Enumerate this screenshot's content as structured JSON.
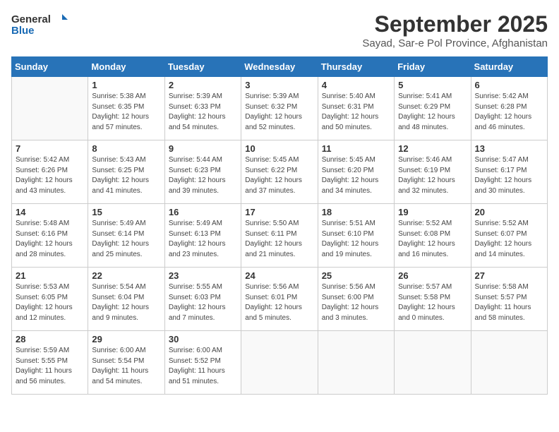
{
  "logo": {
    "line1": "General",
    "line2": "Blue"
  },
  "title": "September 2025",
  "location": "Sayad, Sar-e Pol Province, Afghanistan",
  "weekdays": [
    "Sunday",
    "Monday",
    "Tuesday",
    "Wednesday",
    "Thursday",
    "Friday",
    "Saturday"
  ],
  "weeks": [
    [
      {
        "day": "",
        "info": ""
      },
      {
        "day": "1",
        "info": "Sunrise: 5:38 AM\nSunset: 6:35 PM\nDaylight: 12 hours\nand 57 minutes."
      },
      {
        "day": "2",
        "info": "Sunrise: 5:39 AM\nSunset: 6:33 PM\nDaylight: 12 hours\nand 54 minutes."
      },
      {
        "day": "3",
        "info": "Sunrise: 5:39 AM\nSunset: 6:32 PM\nDaylight: 12 hours\nand 52 minutes."
      },
      {
        "day": "4",
        "info": "Sunrise: 5:40 AM\nSunset: 6:31 PM\nDaylight: 12 hours\nand 50 minutes."
      },
      {
        "day": "5",
        "info": "Sunrise: 5:41 AM\nSunset: 6:29 PM\nDaylight: 12 hours\nand 48 minutes."
      },
      {
        "day": "6",
        "info": "Sunrise: 5:42 AM\nSunset: 6:28 PM\nDaylight: 12 hours\nand 46 minutes."
      }
    ],
    [
      {
        "day": "7",
        "info": "Sunrise: 5:42 AM\nSunset: 6:26 PM\nDaylight: 12 hours\nand 43 minutes."
      },
      {
        "day": "8",
        "info": "Sunrise: 5:43 AM\nSunset: 6:25 PM\nDaylight: 12 hours\nand 41 minutes."
      },
      {
        "day": "9",
        "info": "Sunrise: 5:44 AM\nSunset: 6:23 PM\nDaylight: 12 hours\nand 39 minutes."
      },
      {
        "day": "10",
        "info": "Sunrise: 5:45 AM\nSunset: 6:22 PM\nDaylight: 12 hours\nand 37 minutes."
      },
      {
        "day": "11",
        "info": "Sunrise: 5:45 AM\nSunset: 6:20 PM\nDaylight: 12 hours\nand 34 minutes."
      },
      {
        "day": "12",
        "info": "Sunrise: 5:46 AM\nSunset: 6:19 PM\nDaylight: 12 hours\nand 32 minutes."
      },
      {
        "day": "13",
        "info": "Sunrise: 5:47 AM\nSunset: 6:17 PM\nDaylight: 12 hours\nand 30 minutes."
      }
    ],
    [
      {
        "day": "14",
        "info": "Sunrise: 5:48 AM\nSunset: 6:16 PM\nDaylight: 12 hours\nand 28 minutes."
      },
      {
        "day": "15",
        "info": "Sunrise: 5:49 AM\nSunset: 6:14 PM\nDaylight: 12 hours\nand 25 minutes."
      },
      {
        "day": "16",
        "info": "Sunrise: 5:49 AM\nSunset: 6:13 PM\nDaylight: 12 hours\nand 23 minutes."
      },
      {
        "day": "17",
        "info": "Sunrise: 5:50 AM\nSunset: 6:11 PM\nDaylight: 12 hours\nand 21 minutes."
      },
      {
        "day": "18",
        "info": "Sunrise: 5:51 AM\nSunset: 6:10 PM\nDaylight: 12 hours\nand 19 minutes."
      },
      {
        "day": "19",
        "info": "Sunrise: 5:52 AM\nSunset: 6:08 PM\nDaylight: 12 hours\nand 16 minutes."
      },
      {
        "day": "20",
        "info": "Sunrise: 5:52 AM\nSunset: 6:07 PM\nDaylight: 12 hours\nand 14 minutes."
      }
    ],
    [
      {
        "day": "21",
        "info": "Sunrise: 5:53 AM\nSunset: 6:05 PM\nDaylight: 12 hours\nand 12 minutes."
      },
      {
        "day": "22",
        "info": "Sunrise: 5:54 AM\nSunset: 6:04 PM\nDaylight: 12 hours\nand 9 minutes."
      },
      {
        "day": "23",
        "info": "Sunrise: 5:55 AM\nSunset: 6:03 PM\nDaylight: 12 hours\nand 7 minutes."
      },
      {
        "day": "24",
        "info": "Sunrise: 5:56 AM\nSunset: 6:01 PM\nDaylight: 12 hours\nand 5 minutes."
      },
      {
        "day": "25",
        "info": "Sunrise: 5:56 AM\nSunset: 6:00 PM\nDaylight: 12 hours\nand 3 minutes."
      },
      {
        "day": "26",
        "info": "Sunrise: 5:57 AM\nSunset: 5:58 PM\nDaylight: 12 hours\nand 0 minutes."
      },
      {
        "day": "27",
        "info": "Sunrise: 5:58 AM\nSunset: 5:57 PM\nDaylight: 11 hours\nand 58 minutes."
      }
    ],
    [
      {
        "day": "28",
        "info": "Sunrise: 5:59 AM\nSunset: 5:55 PM\nDaylight: 11 hours\nand 56 minutes."
      },
      {
        "day": "29",
        "info": "Sunrise: 6:00 AM\nSunset: 5:54 PM\nDaylight: 11 hours\nand 54 minutes."
      },
      {
        "day": "30",
        "info": "Sunrise: 6:00 AM\nSunset: 5:52 PM\nDaylight: 11 hours\nand 51 minutes."
      },
      {
        "day": "",
        "info": ""
      },
      {
        "day": "",
        "info": ""
      },
      {
        "day": "",
        "info": ""
      },
      {
        "day": "",
        "info": ""
      }
    ]
  ]
}
